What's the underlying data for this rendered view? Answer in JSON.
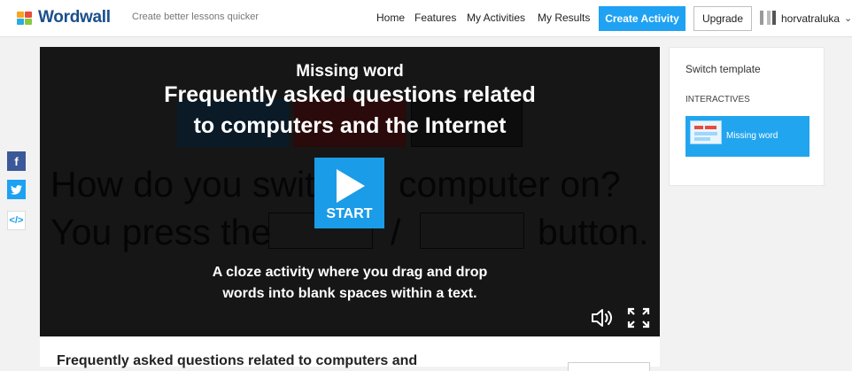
{
  "header": {
    "brand": "Wordwall",
    "tagline": "Create better lessons quicker",
    "nav": [
      "Home",
      "Features",
      "My Activities",
      "My Results"
    ],
    "create_label": "Create Activity",
    "upgrade_label": "Upgrade",
    "username": "horvatraluka",
    "user_caret": "⌄"
  },
  "player": {
    "template_name": "Missing word",
    "title_line1": "Frequently asked questions related",
    "title_line2": "to computers and the Internet",
    "bg_question": "How do you switc",
    "bg_question_end": "computer on?",
    "bg_answer_start": "You press the",
    "bg_slash": "/",
    "bg_answer_end": "button.",
    "start_label": "START",
    "desc_line1": "A cloze activity where you drag and drop",
    "desc_line2": "words into blank spaces within a text."
  },
  "social": {
    "facebook": "f",
    "twitter": "t",
    "embed": "</>"
  },
  "sidebar": {
    "heading": "Switch template",
    "section": "INTERACTIVES",
    "item": "Missing word"
  },
  "activity": {
    "title": "Frequently asked questions related to computers and"
  },
  "colors": {
    "accent": "#1fa2f3",
    "facebook": "#3b5998",
    "twitter": "#1da1f2",
    "embed_bg": "#ffffff"
  }
}
